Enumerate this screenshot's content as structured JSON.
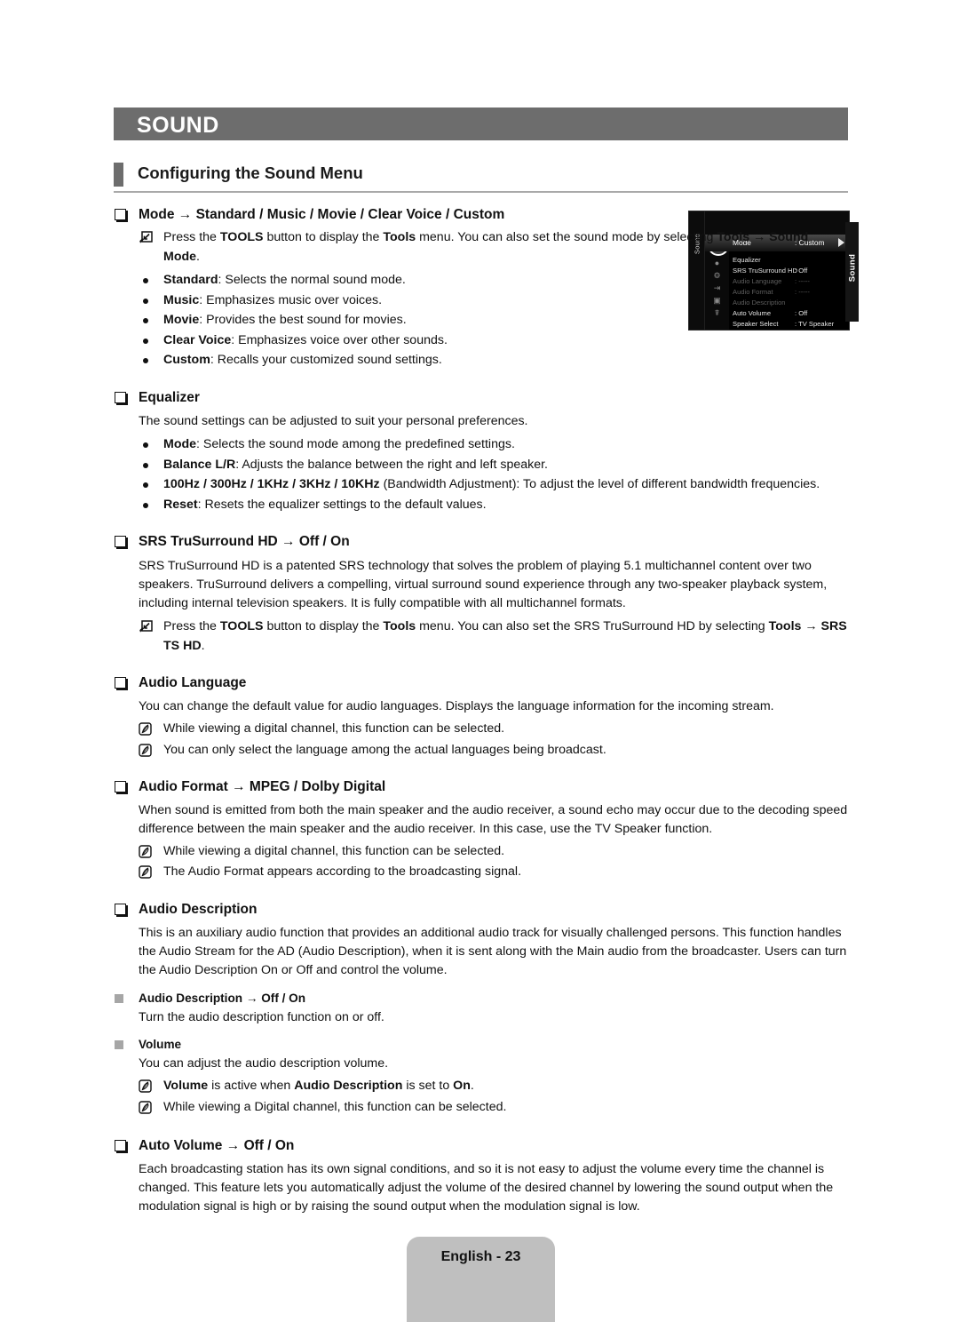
{
  "header": {
    "chapter": "SOUND",
    "section_title": "Configuring the Sound Menu"
  },
  "side_tab": {
    "label": "Sound"
  },
  "osd": {
    "vertical_label": "Sound",
    "rows": [
      {
        "label": "Mode",
        "value": ": Custom",
        "state": "selected"
      },
      {
        "label": "Equalizer",
        "value": "",
        "state": "normal"
      },
      {
        "label": "SRS TruSurround HD",
        "value": ": Off",
        "state": "normal"
      },
      {
        "label": "Audio Language",
        "value": ": -----",
        "state": "dimmed"
      },
      {
        "label": "Audio Format",
        "value": ": -----",
        "state": "dimmed"
      },
      {
        "label": "Audio Description",
        "value": "",
        "state": "dimmed"
      },
      {
        "label": "Auto Volume",
        "value": ": Off",
        "state": "normal"
      },
      {
        "label": "Speaker Select",
        "value": ": TV Speaker",
        "state": "normal"
      }
    ]
  },
  "sections": {
    "mode": {
      "title_a": "Mode",
      "title_arrow": "→",
      "title_b": "Standard / Music / Movie / Clear Voice / Custom",
      "tools_note": {
        "t1": "Press the ",
        "b1": "TOOLS",
        "t2": " button to display the ",
        "b2": "Tools",
        "t3": " menu. You can also set the sound mode by selecting ",
        "b3": "Tools",
        "t4": " → ",
        "b4": "Sound Mode",
        "t5": "."
      },
      "bullets": [
        {
          "term": "Standard",
          "desc": ": Selects the normal sound mode."
        },
        {
          "term": "Music",
          "desc": ": Emphasizes music over voices."
        },
        {
          "term": "Movie",
          "desc": ": Provides the best sound for movies."
        },
        {
          "term": "Clear Voice",
          "desc": ": Emphasizes voice over other sounds."
        },
        {
          "term": "Custom",
          "desc": ": Recalls your customized sound settings."
        }
      ]
    },
    "equalizer": {
      "title": "Equalizer",
      "intro": "The sound settings can be adjusted to suit your personal preferences.",
      "bullets": [
        {
          "term": "Mode",
          "desc": ": Selects the sound mode among the predefined settings."
        },
        {
          "term": "Balance L/R",
          "desc": ": Adjusts the balance between the right and left speaker."
        },
        {
          "term": "100Hz / 300Hz / 1KHz / 3KHz / 10KHz",
          "desc": " (Bandwidth Adjustment): To adjust the level of different bandwidth frequencies."
        },
        {
          "term": "Reset",
          "desc": ": Resets the equalizer settings to the default values."
        }
      ]
    },
    "srs": {
      "title_a": "SRS TruSurround HD",
      "title_arrow": "→",
      "title_b": "Off / On",
      "body": "SRS TruSurround HD is a patented SRS technology that solves the problem of playing 5.1 multichannel content over two speakers. TruSurround delivers a compelling, virtual surround sound experience through any two-speaker playback system, including internal television speakers. It is fully compatible with all multichannel formats.",
      "tools_note": {
        "t1": "Press the ",
        "b1": "TOOLS",
        "t2": " button to display the ",
        "b2": "Tools",
        "t3": " menu. You can also set the SRS TruSurround HD by selecting ",
        "b3": "Tools",
        "t4": " → ",
        "b4": "SRS TS HD",
        "t5": "."
      }
    },
    "audio_language": {
      "title": "Audio Language",
      "body": "You can change the default value for audio languages. Displays the language information for the incoming stream.",
      "notes": [
        "While viewing a digital channel, this function can be selected.",
        "You can only select the language among the actual languages being broadcast."
      ]
    },
    "audio_format": {
      "title_a": "Audio Format",
      "title_arrow": "→",
      "title_b": "MPEG / Dolby Digital",
      "body": "When sound is emitted from both the main speaker and the audio receiver, a sound echo may occur due to the decoding speed difference between the main speaker and the audio receiver. In this case, use the TV Speaker function.",
      "notes": [
        "While viewing a digital channel, this function can be selected.",
        "The Audio Format appears according to the broadcasting signal."
      ]
    },
    "audio_description": {
      "title": "Audio Description",
      "body": "This is an auxiliary audio function that provides an additional audio track for visually challenged persons. This function handles the Audio Stream for the AD (Audio Description), when it is sent along with the Main audio from the broadcaster. Users can turn the Audio Description On or Off and control the volume.",
      "sub1": {
        "title_a": "Audio Description",
        "title_arrow": "→",
        "title_b": "Off / On",
        "body": "Turn the audio description function on or off."
      },
      "sub2": {
        "title": "Volume",
        "body": "You can adjust the audio description volume.",
        "note1": {
          "b1": "Volume",
          "t1": " is active when ",
          "b2": "Audio Description",
          "t2": " is set to ",
          "b3": "On",
          "t3": "."
        },
        "note2": "While viewing a Digital channel, this function can be selected."
      }
    },
    "auto_volume": {
      "title_a": "Auto Volume",
      "title_arrow": "→",
      "title_b": "Off / On",
      "body": "Each broadcasting station has its own signal conditions, and so it is not easy to adjust the volume every time the channel is changed. This feature lets you automatically adjust the volume of the desired channel by lowering the sound output when the modulation signal is high or by raising the sound output when the modulation signal is low."
    }
  },
  "footer": {
    "page_label": "English - 23"
  }
}
